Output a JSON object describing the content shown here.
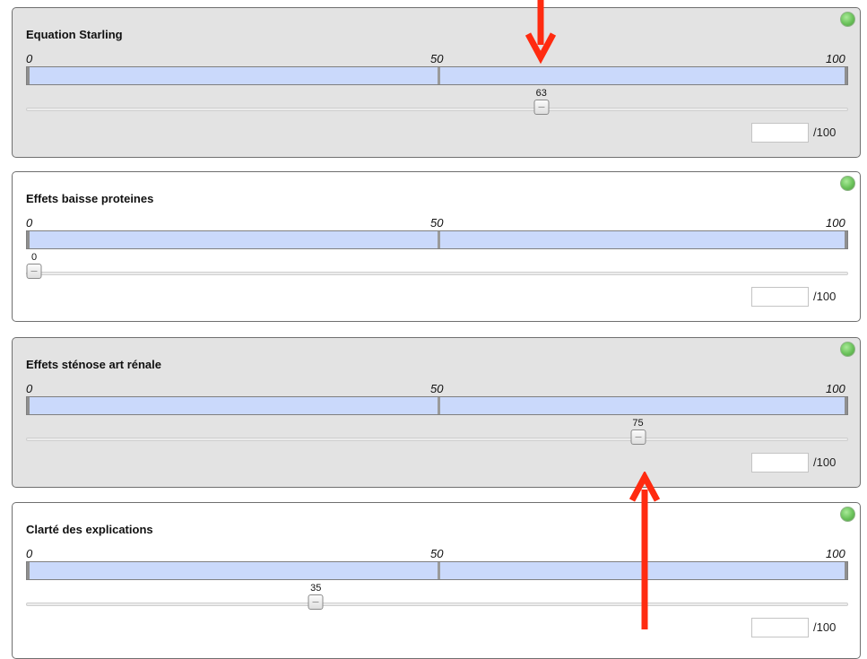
{
  "scale": {
    "min": "0",
    "mid": "50",
    "max": "100"
  },
  "out_of": "/100",
  "colors": {
    "panel_shaded": "#e3e3e3",
    "bar_fill": "#cad9fb",
    "status_green": "#6ac25a",
    "arrow_red": "#ff2b10"
  },
  "panels": [
    {
      "title": "Equation Starling",
      "value": 63,
      "value_label": "63",
      "input_value": "",
      "status_icon": "green-status-icon",
      "shaded": true
    },
    {
      "title": "Effets baisse proteines",
      "value": 0,
      "value_label": "0",
      "input_value": "",
      "status_icon": "green-status-icon",
      "shaded": false
    },
    {
      "title": "Effets sténose art rénale",
      "value": 75,
      "value_label": "75",
      "input_value": "",
      "status_icon": "green-status-icon",
      "shaded": true
    },
    {
      "title": "Clarté des explications",
      "value": 35,
      "value_label": "35",
      "input_value": "",
      "status_icon": "green-status-icon",
      "shaded": false
    }
  ],
  "annotations": [
    {
      "icon": "red-arrow-down-icon",
      "points_to": "Equation Starling slider"
    },
    {
      "icon": "red-arrow-up-icon",
      "points_to": "Effets sténose art rénale slider"
    }
  ]
}
